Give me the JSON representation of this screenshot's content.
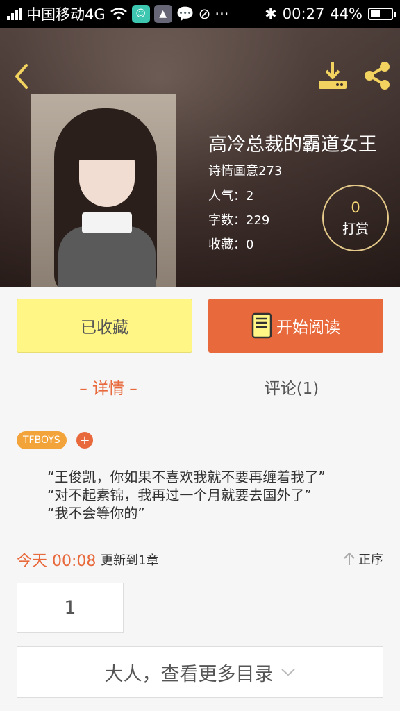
{
  "status_bar": {
    "carrier": "中国移动4G",
    "time": "00:27",
    "battery": "44%",
    "battery_level": 0.44,
    "icons": [
      "signal-icon",
      "wifi-icon",
      "app-icon",
      "gallery-icon",
      "chat-icon",
      "eye-icon",
      "more-dots-icon",
      "bluetooth-icon",
      "battery-icon"
    ]
  },
  "header": {
    "back_icon": "chevron-left-icon",
    "download_icon": "download-icon",
    "share_icon": "share-icon"
  },
  "book": {
    "title": "高冷总裁的霸道女王",
    "author": "诗情画意273",
    "popularity": "人气：2",
    "word_count": "字数：229",
    "favorites": "收藏：0"
  },
  "reward": {
    "count": "0",
    "label": "打赏"
  },
  "actions": {
    "favorite_label": "已收藏",
    "read_label": "开始阅读"
  },
  "tabs": {
    "detail": "– 详情 –",
    "comments": "评论(1)"
  },
  "tags": {
    "items": [
      "TFBOYS"
    ],
    "add": "+"
  },
  "intro": {
    "lines": [
      "“王俊凯，你如果不喜欢我就不要再缠着我了”",
      "“对不起素锦，我再过一个月就要去国外了”",
      "“我不会等你的”"
    ]
  },
  "update": {
    "time": "今天 00:08",
    "text": "更新到1章",
    "order_label": "正序"
  },
  "chapters": {
    "first": "1"
  },
  "more": {
    "label": "大人，查看更多目录"
  },
  "colors": {
    "accent": "#e8693c",
    "yellow": "#fff685",
    "tag": "#f2a33a"
  }
}
